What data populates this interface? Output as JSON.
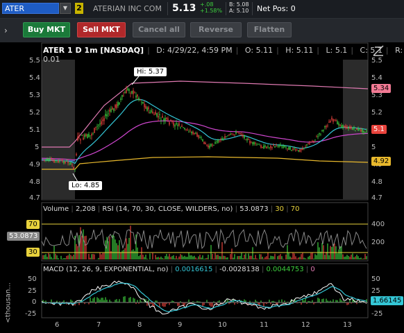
{
  "topbar": {
    "symbol": "ATER",
    "badge": "2",
    "company": "ATERIAN INC COM",
    "last": "5.13",
    "change": "+.08",
    "change_pct": "+1.58%",
    "bid": "B: 5.08",
    "ask": "A: 5.10",
    "net_pos": "Net Pos: 0"
  },
  "order_bar": {
    "buy": "Buy MKT",
    "sell": "Sell MKT",
    "cancel": "Cancel all",
    "reverse": "Reverse",
    "flatten": "Flatten"
  },
  "chart": {
    "symbol_label": "ATER 1 D 1m [NASDAQ]",
    "date": "D: 4/29/22, 4:59 PM",
    "open": "O: 5.11",
    "high": "H: 5.11",
    "low": "L: 5.1",
    "close": "C: 5.1",
    "range": "R: 0.01",
    "hi_label": "Hi: 5.37",
    "lo_label": "Lo: 4.85",
    "price_ticks": [
      "5.5",
      "5.4",
      "5.3",
      "5.2",
      "5.1",
      "5",
      "4.9",
      "4.8",
      "4.7"
    ],
    "tag_534": "5.34",
    "tag_51": "5.1",
    "tag_492": "4.92",
    "x_ticks": [
      "6",
      "7",
      "8",
      "9",
      "10",
      "11",
      "12",
      "13"
    ],
    "colors": {
      "up": "#3ecf3e",
      "down": "#e8433c",
      "ema_fast": "#34c6d6",
      "ema_slow": "#d147d1",
      "vwap_like": "#e8b82c",
      "pink": "#e07ab2"
    }
  },
  "volume_panel": {
    "label": "Volume",
    "volume": "2,208",
    "rsi_label": "RSI (14, 70, 30, CLOSE, WILDERS, no)",
    "rsi_value": "53.0873",
    "ob": "30",
    "os": "70",
    "left_70": "70",
    "left_value": "53.0873",
    "left_30": "30",
    "right_ticks": [
      "400",
      "200"
    ]
  },
  "macd_panel": {
    "label": "MACD (12, 26, 9, EXPONENTIAL, no)",
    "value": "0.0016615",
    "avg": "-0.0028138",
    "diff": "0.0044753",
    "zero": "0",
    "left_ticks": [
      "50",
      "25",
      "0",
      "-25"
    ],
    "right_ticks": [
      "50",
      "25",
      "0",
      "-25"
    ],
    "tag": "1.66145",
    "left_unit": "<thousan..."
  }
}
